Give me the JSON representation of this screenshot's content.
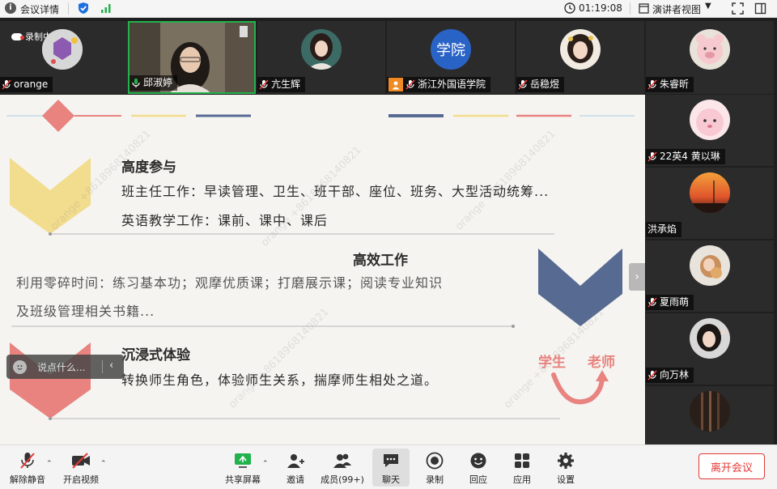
{
  "topbar": {
    "meeting_info": "会议详情",
    "time": "01:19:08",
    "view_mode": "演讲者视图"
  },
  "participants_top": [
    {
      "name": "orange",
      "muted": true,
      "recording": "录制中"
    },
    {
      "name": "邱淑婷",
      "muted": false,
      "active": true
    },
    {
      "name": "亢生辉",
      "muted": true
    },
    {
      "name": "浙江外国语学院",
      "muted": true,
      "avatar_text": "学院"
    },
    {
      "name": "岳稳煜",
      "muted": true
    },
    {
      "name": "朱睿昕",
      "muted": true
    }
  ],
  "participants_side": [
    {
      "name": "22英4 黄以琳",
      "muted": true
    },
    {
      "name": "洪承焰",
      "muted": false
    },
    {
      "name": "夏雨萌",
      "muted": true
    },
    {
      "name": "向万林",
      "muted": true
    },
    {
      "name": "",
      "muted": true
    }
  ],
  "slide": {
    "section1_title": "高度参与",
    "section1_line1": "班主任工作：早读管理、卫生、班干部、座位、班务、大型活动统筹...",
    "section1_line2": "英语教学工作：课前、课中、课后",
    "section2_title": "高效工作",
    "section2_line1": "利用零碎时间：练习基本功；观摩优质课；打磨展示课；阅读专业知识",
    "section2_line2": "及班级管理相关书籍...",
    "section3_title": "沉浸式体验",
    "section3_line1": "转换师生角色，体验师生关系，揣摩师生相处之道。",
    "label_student": "学生",
    "label_teacher": "老师",
    "watermark": "orange +8618968140821",
    "colors": {
      "yellow": "#f2dc8e",
      "pink": "#e8837f",
      "navy": "#566a92",
      "text": "#2a2a2a",
      "gray_text": "#555555"
    }
  },
  "chat_input": {
    "placeholder": "说点什么..."
  },
  "toolbar": {
    "unmute": "解除静音",
    "start_video": "开启视频",
    "share_screen": "共享屏幕",
    "invite": "邀请",
    "members": "成员(99+)",
    "chat": "聊天",
    "record": "录制",
    "reactions": "回应",
    "apps": "应用",
    "settings": "设置",
    "leave": "离开会议"
  },
  "accent_green": "#22b24c"
}
